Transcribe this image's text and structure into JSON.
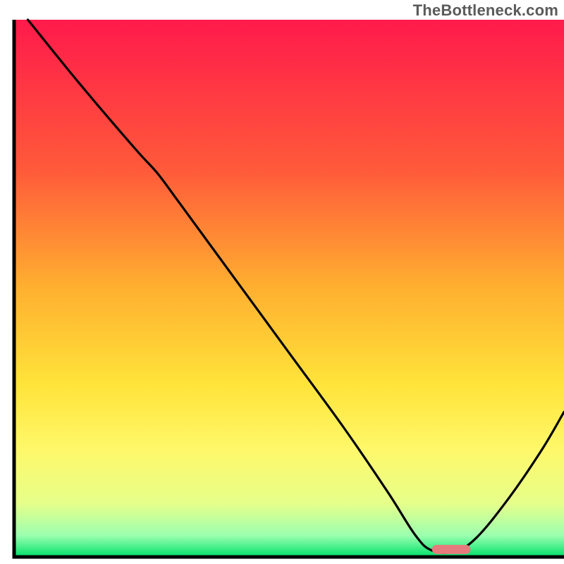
{
  "watermark": "TheBottleneck.com",
  "chart_data": {
    "type": "line",
    "title": "",
    "xlabel": "",
    "ylabel": "",
    "xlim": [
      0,
      100
    ],
    "ylim": [
      0,
      100
    ],
    "gradient_stops": [
      {
        "offset": 0,
        "color": "#ff1a4b"
      },
      {
        "offset": 28,
        "color": "#ff5a3a"
      },
      {
        "offset": 50,
        "color": "#ffb030"
      },
      {
        "offset": 68,
        "color": "#ffe43a"
      },
      {
        "offset": 80,
        "color": "#fff86a"
      },
      {
        "offset": 90,
        "color": "#e6ff8a"
      },
      {
        "offset": 96,
        "color": "#9cffb0"
      },
      {
        "offset": 100,
        "color": "#00e06a"
      }
    ],
    "curve_points": [
      {
        "x": 2.5,
        "y": 100
      },
      {
        "x": 12,
        "y": 88
      },
      {
        "x": 22,
        "y": 76
      },
      {
        "x": 26,
        "y": 71.5
      },
      {
        "x": 30,
        "y": 66
      },
      {
        "x": 40,
        "y": 52
      },
      {
        "x": 50,
        "y": 38
      },
      {
        "x": 60,
        "y": 24
      },
      {
        "x": 68,
        "y": 12
      },
      {
        "x": 73,
        "y": 4
      },
      {
        "x": 76,
        "y": 1.2
      },
      {
        "x": 80,
        "y": 1.0
      },
      {
        "x": 84,
        "y": 3.5
      },
      {
        "x": 90,
        "y": 11
      },
      {
        "x": 96,
        "y": 20
      },
      {
        "x": 100,
        "y": 27
      }
    ],
    "marker": {
      "x_start": 76,
      "x_end": 83,
      "y": 1.4,
      "color": "#e77a7d"
    },
    "frame": {
      "left": 2.5,
      "right": 100,
      "bottom": 0
    }
  }
}
